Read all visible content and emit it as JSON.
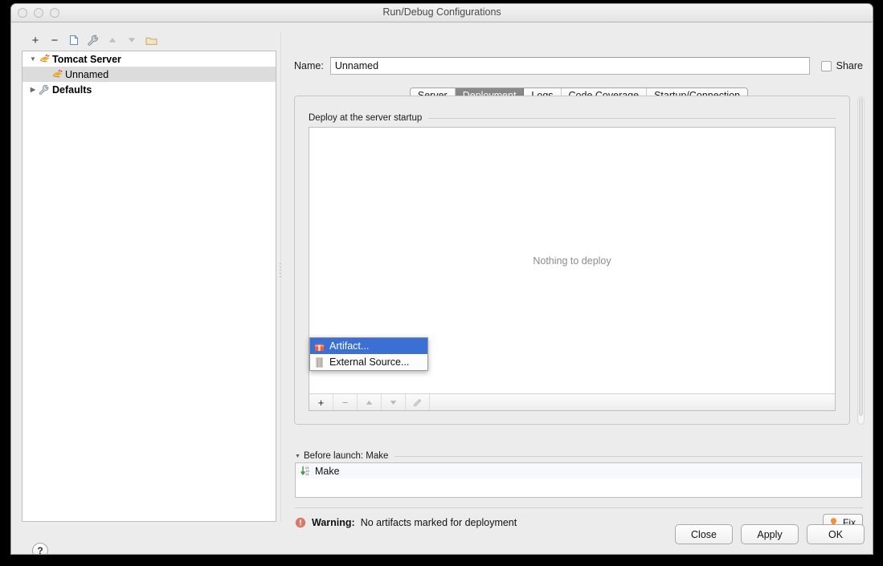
{
  "window": {
    "title": "Run/Debug Configurations",
    "traffic_lights": [
      "close-button",
      "minimize-button",
      "zoom-button"
    ]
  },
  "tree_toolbar": {
    "buttons": [
      {
        "name": "add-configuration-button",
        "icon": "plus-icon",
        "glyph": "+",
        "enabled": true
      },
      {
        "name": "remove-configuration-button",
        "icon": "minus-icon",
        "glyph": "−",
        "enabled": true
      },
      {
        "name": "copy-configuration-button",
        "icon": "copy-icon",
        "glyph": "",
        "enabled": true
      },
      {
        "name": "edit-defaults-button",
        "icon": "wrench-icon",
        "glyph": "",
        "enabled": true
      },
      {
        "name": "move-up-button",
        "icon": "arrow-up-icon",
        "glyph": "▲",
        "enabled": false
      },
      {
        "name": "move-down-button",
        "icon": "arrow-down-icon",
        "glyph": "▼",
        "enabled": false
      },
      {
        "name": "new-folder-button",
        "icon": "folder-icon",
        "glyph": "",
        "enabled": true
      }
    ]
  },
  "tree": {
    "items": [
      {
        "label": "Tomcat Server",
        "icon": "tomcat-icon",
        "expanded": true,
        "bold": true,
        "selected": false,
        "level": 0
      },
      {
        "label": "Unnamed",
        "icon": "tomcat-icon",
        "expanded": null,
        "bold": false,
        "selected": true,
        "level": 1
      },
      {
        "label": "Defaults",
        "icon": "wrench-icon",
        "expanded": false,
        "bold": true,
        "selected": false,
        "level": 0
      }
    ]
  },
  "name_field": {
    "label": "Name:",
    "value": "Unnamed",
    "placeholder": ""
  },
  "share": {
    "label": "Share",
    "checked": false
  },
  "tabs": [
    {
      "label": "Server",
      "active": false
    },
    {
      "label": "Deployment",
      "active": true
    },
    {
      "label": "Logs",
      "active": false
    },
    {
      "label": "Code Coverage",
      "active": false
    },
    {
      "label": "Startup/Connection",
      "active": false
    }
  ],
  "deployment": {
    "group_label": "Deploy at the server startup",
    "empty_text": "Nothing to deploy",
    "toolbar": [
      {
        "name": "add-deployment-button",
        "icon": "plus-icon",
        "glyph": "+",
        "enabled": true
      },
      {
        "name": "remove-deployment-button",
        "icon": "minus-icon",
        "glyph": "−",
        "enabled": false
      },
      {
        "name": "move-up-deployment-button",
        "icon": "arrow-up-icon",
        "glyph": "▲",
        "enabled": false
      },
      {
        "name": "move-down-deployment-button",
        "icon": "arrow-down-icon",
        "glyph": "▼",
        "enabled": false
      },
      {
        "name": "edit-deployment-button",
        "icon": "pencil-icon",
        "glyph": "",
        "enabled": false
      }
    ]
  },
  "popup_menu": {
    "items": [
      {
        "label": "Artifact...",
        "icon": "artifact-icon",
        "selected": true
      },
      {
        "label": "External Source...",
        "icon": "external-source-icon",
        "selected": false
      }
    ]
  },
  "before_launch": {
    "header": "Before launch: Make",
    "expanded": true,
    "items": [
      {
        "label": "Make",
        "icon": "make-icon"
      }
    ]
  },
  "status": {
    "warning_prefix": "Warning:",
    "warning_message": "No artifacts marked for deployment",
    "fix_label": "Fix",
    "fix_icon": "lightbulb-icon",
    "warning_icon": "warning-circle-icon"
  },
  "footer": {
    "help_label": "?",
    "close_label": "Close",
    "apply_label": "Apply",
    "ok_label": "OK"
  },
  "colors": {
    "selection_blue": "#3b6fd4",
    "tab_active_gray": "#8b8b8b",
    "warning_salmon": "#d97a68",
    "window_bg": "#ececec"
  }
}
